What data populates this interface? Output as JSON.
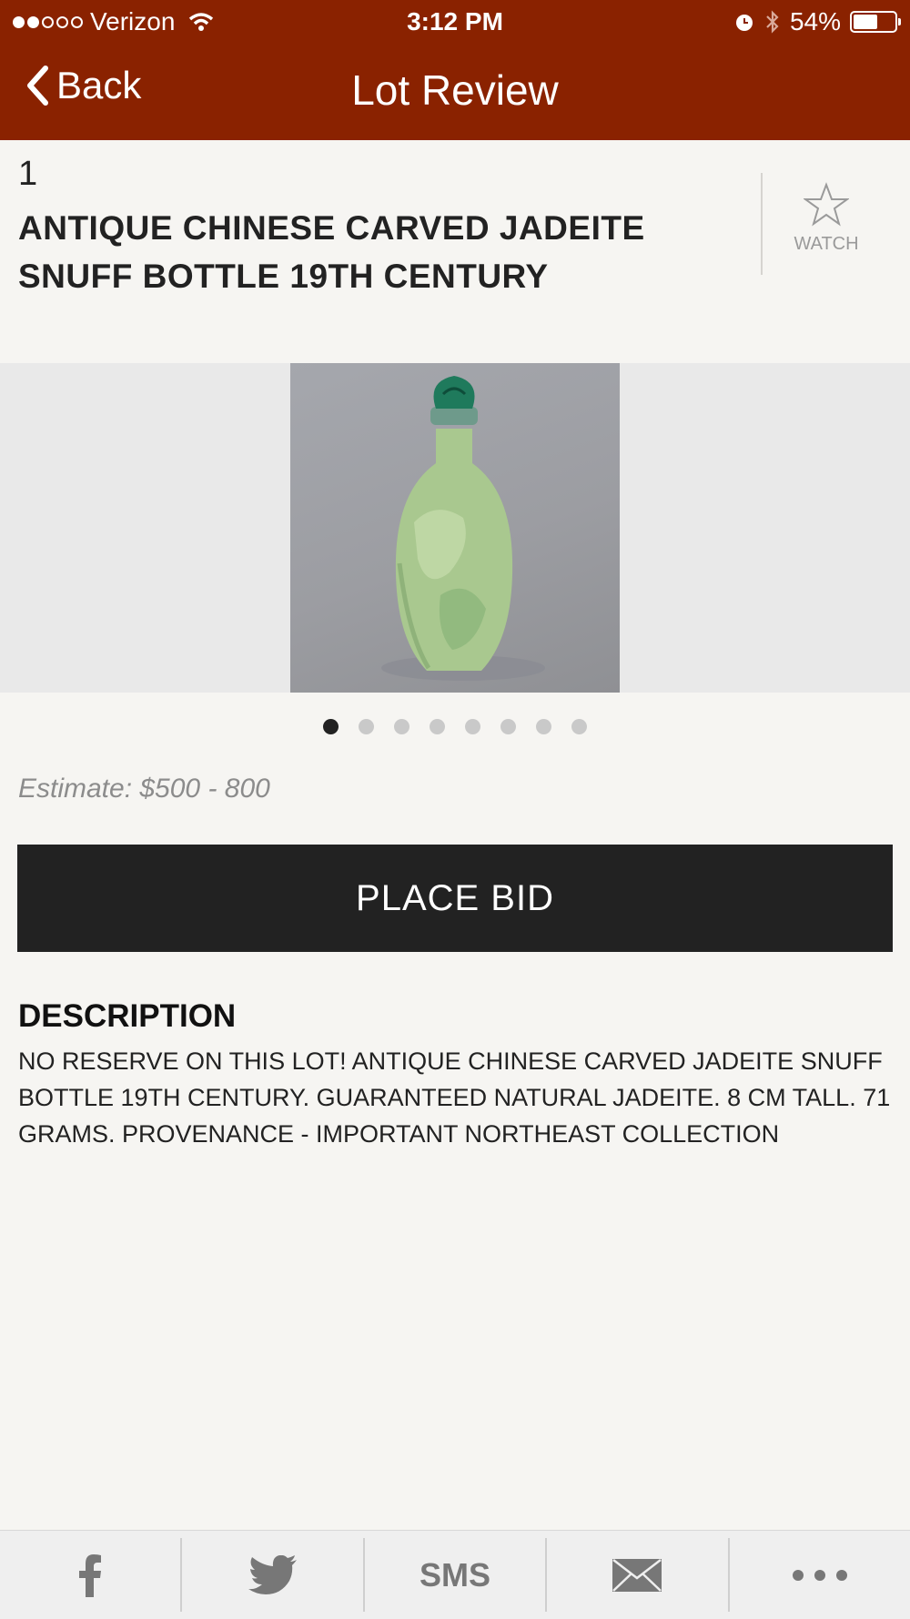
{
  "status_bar": {
    "carrier": "Verizon",
    "time": "3:12 PM",
    "battery": "54%",
    "battery_level": 0.54
  },
  "nav": {
    "back_label": "Back",
    "title": "Lot Review"
  },
  "lot": {
    "number": "1",
    "title": "ANTIQUE CHINESE CARVED JADEITE SNUFF BOTTLE 19TH CENTURY",
    "watch_label": "WATCH",
    "estimate": "Estimate: $500 - 800",
    "image_count": 8,
    "active_image": 1
  },
  "actions": {
    "place_bid_label": "PLACE BID"
  },
  "description": {
    "heading": "DESCRIPTION",
    "text": "NO RESERVE ON THIS LOT!   ANTIQUE CHINESE CARVED JADEITE SNUFF BOTTLE 19TH CENTURY.  GUARANTEED NATURAL JADEITE.  8 CM TALL.  71 GRAMS.  PROVENANCE - IMPORTANT NORTHEAST COLLECTION"
  },
  "share_bar": {
    "items": [
      {
        "icon": "facebook-icon"
      },
      {
        "icon": "twitter-icon"
      },
      {
        "icon": "sms-icon",
        "label": "SMS"
      },
      {
        "icon": "mail-icon"
      },
      {
        "icon": "more-icon"
      }
    ]
  },
  "colors": {
    "header": "#8a2200",
    "button": "#222222",
    "background": "#f6f5f2"
  }
}
